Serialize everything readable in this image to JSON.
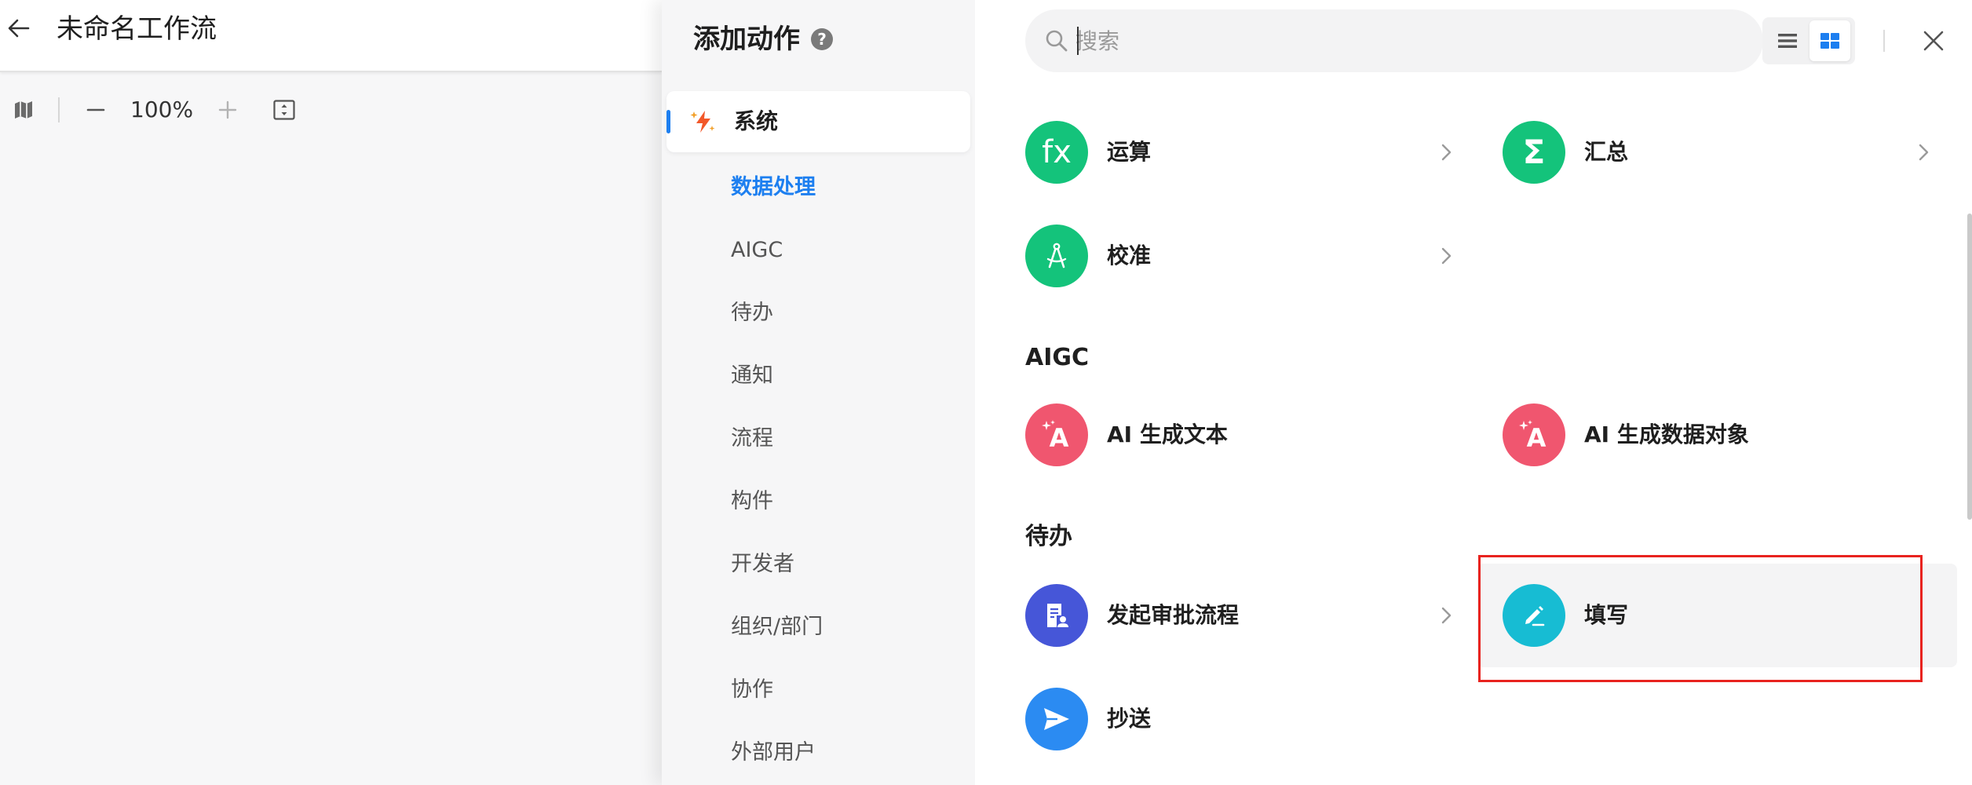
{
  "workflow": {
    "title": "未命名工作流",
    "zoom": "100%"
  },
  "panel": {
    "title": "添加动作",
    "help": "?",
    "active_category": "系统",
    "categories": [
      "数据处理",
      "AIGC",
      "待办",
      "通知",
      "流程",
      "构件",
      "开发者",
      "组织/部门",
      "协作",
      "外部用户"
    ],
    "selected_category": "数据处理"
  },
  "search": {
    "placeholder": "搜索",
    "value": ""
  },
  "sections": {
    "aigc": "AIGC",
    "todo": "待办"
  },
  "actions": {
    "calc": "运算",
    "summary": "汇总",
    "calibrate": "校准",
    "ai_text": "AI 生成文本",
    "ai_object": "AI 生成数据对象",
    "approval": "发起审批流程",
    "fill": "填写",
    "cc": "抄送"
  },
  "icon_glyphs": {
    "fx": "fx",
    "sigma": "Σ",
    "ai": "A"
  },
  "colors": {
    "accent": "#1d7ff0",
    "green": "#14c37b",
    "pink": "#f0566f",
    "indigo": "#4656d8",
    "teal": "#17bcd3",
    "blue": "#2b8bf2",
    "highlight": "#e8231f"
  }
}
